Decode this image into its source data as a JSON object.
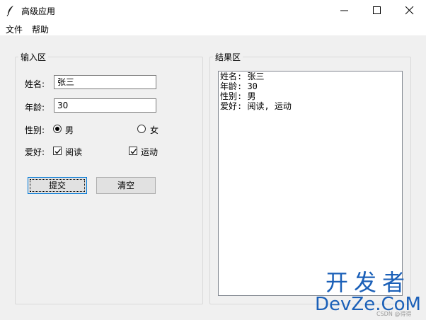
{
  "window": {
    "title": "高级应用",
    "icons": [
      "feather-icon",
      "minimize-icon",
      "maximize-icon",
      "close-icon"
    ]
  },
  "menu": {
    "file": "文件",
    "help": "帮助"
  },
  "input_frame": {
    "title": "输入区",
    "name_label": "姓名:",
    "name_value": "张三",
    "age_label": "年龄:",
    "age_value": "30",
    "gender_label": "性别:",
    "gender_male": "男",
    "gender_female": "女",
    "gender_selected": "男",
    "hobby_label": "爱好:",
    "hobby_reading": "阅读",
    "hobby_sports": "运动",
    "submit": "提交",
    "clear": "清空"
  },
  "result_frame": {
    "title": "结果区",
    "lines": [
      "姓名: 张三",
      "年龄: 30",
      "性别: 男",
      "爱好: 阅读, 运动"
    ]
  },
  "watermark": {
    "line1": "开发者",
    "line2": "DevZe.CoM",
    "csdn": "CSDN @得得"
  },
  "colors": {
    "accent": "#0078d7",
    "watermark": "#1b60b8"
  }
}
